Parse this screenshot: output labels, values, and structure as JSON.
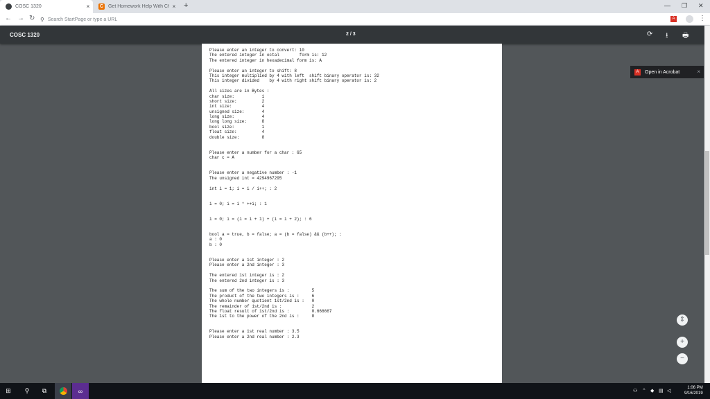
{
  "browser": {
    "tabs": [
      {
        "title": "COSC 1320",
        "icon": "chrome-icon",
        "close": "×"
      },
      {
        "title": "Get Homework Help With Cheg",
        "icon": "chegg-icon",
        "close": "×"
      }
    ],
    "new_tab": "+",
    "window_controls": {
      "minimize": "—",
      "maximize": "❐",
      "close": "✕"
    },
    "nav": {
      "back": "←",
      "forward": "→",
      "reload": "↻"
    },
    "omnibox_placeholder": "Search StartPage or type a URL",
    "menu": "⋮"
  },
  "pdf_viewer": {
    "title": "COSC 1320",
    "page_indicator": "2 / 3",
    "icons": {
      "rotate": "⟳",
      "download": "⭳",
      "print": "🖶"
    }
  },
  "document": {
    "lines": [
      "Please enter an integer to convert: 10",
      "The entered integer in octal        form is: 12",
      "The entered integer in hexadecimal form is: A",
      "",
      "Please enter an integer to shift: 8",
      "This integer multiplied by 4 with left  shift binary operator is: 32",
      "This integer divided    by 4 with right shift binary operator is: 2",
      "",
      "All sizes are in Bytes :",
      "char size:           1",
      "short size:          2",
      "int size:            4",
      "unsigned size:       4",
      "long size:           4",
      "long long size:      8",
      "bool size:           1",
      "float size:          4",
      "double size:         8",
      "",
      "",
      "Please enter a number for a char : 65",
      "char c = A",
      "",
      "",
      "Please enter a negative number : -1",
      "The unsigned int = 4294967295",
      "",
      "int i = 1; i = i / i++; : 2",
      "",
      "",
      "i = 0; i = i * ++i; : 1",
      "",
      "",
      "i = 0; i = (i = i + 1) + (i = i + 2); : 6",
      "",
      "",
      "bool a = true, b = false; a = (b = false) && (b++); :",
      "a : 0",
      "b : 0",
      "",
      "",
      "Please enter a 1st integer : 2",
      "Please enter a 2nd integer : 3",
      "",
      "The entered 1st integer is : 2",
      "The entered 2nd integer is : 3",
      "",
      "The sum of the two integers is :         5",
      "The product of the two integers is :     6",
      "The whole number quotient 1st/2nd is :   0",
      "The remainder of 1st/2nd is :            2",
      "The float result of 1st/2nd is :         0.666667",
      "The 1st to the power of the 2nd is :     8",
      "",
      "",
      "Please enter a 1st real number : 3.5",
      "Please enter a 2nd real number : 2.3"
    ]
  },
  "acrobat_popup": {
    "label": "Open in Acrobat",
    "close": "×"
  },
  "zoom": {
    "fit": "⇕",
    "zoom_in": "+",
    "zoom_out": "−"
  },
  "taskbar": {
    "start": "⊞",
    "search": "⚲",
    "task_view": "⧉",
    "clock_time": "1:06 PM",
    "clock_date": "9/16/2019"
  }
}
